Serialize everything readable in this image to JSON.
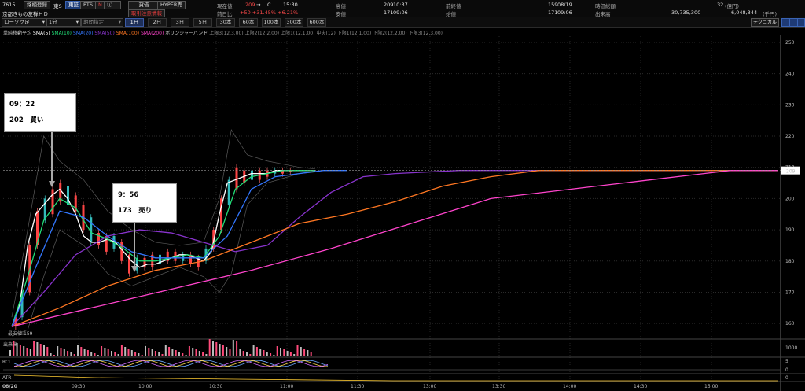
{
  "header": {
    "code": "7615",
    "register_label": "銘柄登録",
    "exchange": "東S",
    "company": "京都きもの友禅ＨＤ",
    "toshou_btn": "東証",
    "pts_btn": "PTS",
    "n_btn": "N",
    "ita_btn": "建",
    "hyper_btn": "HYPER売",
    "trade_btn": "貸借",
    "warning": "取引注意情報",
    "fields": [
      {
        "label": "現在値",
        "value": "209",
        "extra": "C",
        "time": "15:30"
      },
      {
        "label": "前日比",
        "value": "+50  +31.45%  +6.21%"
      },
      {
        "label": "高値",
        "value": "209",
        "time": "10:37"
      },
      {
        "label": "安値",
        "value": "171",
        "time": "09:06"
      },
      {
        "label": "前終値",
        "value": "159",
        "time": "08/19"
      },
      {
        "label": "始値",
        "value": "171",
        "time": "09:06"
      },
      {
        "label": "時価総額",
        "value": "32",
        "unit": "(億円)"
      },
      {
        "label": "出来高",
        "value": "30,735,300",
        "extra": "6,048,344",
        "unit": "(千円)"
      }
    ]
  },
  "toolbar": {
    "chart_type": "ローソク足",
    "interval": "1分",
    "period": "期間指定",
    "ranges": [
      "1日",
      "2日",
      "3日",
      "5日",
      "30本",
      "60本",
      "100本",
      "300本",
      "600本"
    ],
    "active_range": "1日",
    "technical_btn": "テクニカル"
  },
  "legend": [
    {
      "text": "単純移動平均",
      "color": "#cccccc"
    },
    {
      "text": "SMA(5)",
      "color": "#ffffff"
    },
    {
      "text": "SMA(10)",
      "color": "#22dd77"
    },
    {
      "text": "SMA(20)",
      "color": "#3377ff"
    },
    {
      "text": "SMA(50)",
      "color": "#8833cc"
    },
    {
      "text": "SMA(100)",
      "color": "#ff7722"
    },
    {
      "text": "SMA(200)",
      "color": "#ff44cc"
    },
    {
      "text": "ボリンジャーバンド",
      "color": "#cccccc"
    },
    {
      "text": "上限3(12,3.00)",
      "color": "#888888"
    },
    {
      "text": "上限2(12,2.00)",
      "color": "#888888"
    },
    {
      "text": "上限1(12,1.00)",
      "color": "#888888"
    },
    {
      "text": "中央(12)",
      "color": "#888888"
    },
    {
      "text": "下限1(12,1.00)",
      "color": "#888888"
    },
    {
      "text": "下限2(12,2.00)",
      "color": "#888888"
    },
    {
      "text": "下限3(12,3.00)",
      "color": "#888888"
    }
  ],
  "annotations": [
    {
      "time": "09：22",
      "text": "202　買い"
    },
    {
      "time": "9：56",
      "text": "173　売り"
    }
  ],
  "price_tag": "209",
  "low_label": "最安値:159",
  "volume_label": "出来高",
  "volume_axis": "1000",
  "rci_label": "RCI",
  "rci_axis": [
    "5",
    "0"
  ],
  "atr_label": "ATR",
  "atr_axis": "0",
  "date_label": "08/20",
  "chart_data": {
    "type": "line",
    "y_ticks": [
      160,
      170,
      180,
      190,
      200,
      210,
      220,
      230,
      240,
      250
    ],
    "ylim": [
      155,
      252
    ],
    "x_ticks": [
      "09:30",
      "10:00",
      "10:30",
      "11:00",
      "11:30",
      "13:00",
      "13:30",
      "14:00",
      "14:30",
      "15:00"
    ],
    "series": [
      {
        "name": "SMA(5)",
        "color": "#ffffff",
        "x": [
          0,
          10,
          20,
          30,
          40,
          50,
          60,
          70,
          80,
          90,
          100,
          110,
          120,
          130,
          140,
          150,
          160,
          170,
          180,
          190,
          200,
          210,
          220,
          230,
          240,
          250,
          260,
          270,
          280,
          290,
          300,
          310,
          320,
          330,
          340,
          350,
          360,
          370,
          380
        ],
        "values": [
          159,
          166,
          185,
          195,
          198,
          201,
          203,
          200,
          195,
          188,
          186,
          186,
          187,
          186,
          183,
          180,
          178,
          179,
          179,
          180,
          181,
          182,
          182,
          181,
          180,
          183,
          195,
          205,
          206,
          207,
          208,
          208,
          208,
          209,
          209,
          209,
          209,
          209,
          209
        ]
      },
      {
        "name": "SMA(10)",
        "color": "#22dd77",
        "x": [
          0,
          20,
          40,
          60,
          80,
          100,
          120,
          140,
          160,
          180,
          200,
          220,
          240,
          260,
          280,
          300,
          320,
          340,
          360,
          380
        ],
        "values": [
          159,
          175,
          193,
          200,
          197,
          189,
          187,
          184,
          180,
          180,
          181,
          182,
          181,
          188,
          203,
          207,
          208,
          209,
          209,
          209
        ]
      },
      {
        "name": "SMA(20)",
        "color": "#3377ff",
        "x": [
          0,
          30,
          60,
          90,
          120,
          150,
          180,
          210,
          240,
          270,
          300,
          330,
          360,
          390,
          420
        ],
        "values": [
          159,
          178,
          196,
          194,
          188,
          183,
          181,
          181,
          181,
          188,
          203,
          207,
          208,
          209,
          209
        ]
      },
      {
        "name": "SMA(50)",
        "color": "#8833cc",
        "x": [
          0,
          40,
          80,
          120,
          160,
          200,
          240,
          280,
          320,
          360,
          400,
          440,
          480,
          560,
          640,
          720,
          800,
          880,
          960
        ],
        "values": [
          159,
          170,
          182,
          188,
          190,
          189,
          186,
          183,
          185,
          194,
          202,
          207,
          208,
          209,
          209,
          209,
          209,
          209,
          209
        ]
      },
      {
        "name": "SMA(100)",
        "color": "#ff7722",
        "x": [
          0,
          60,
          120,
          180,
          240,
          300,
          360,
          420,
          480,
          540,
          600,
          660,
          720,
          800,
          880,
          960
        ],
        "values": [
          159,
          165,
          172,
          177,
          180,
          186,
          192,
          195,
          199,
          204,
          207,
          209,
          209,
          209,
          209,
          209
        ]
      },
      {
        "name": "SMA(200)",
        "color": "#ff44cc",
        "x": [
          0,
          100,
          200,
          300,
          400,
          500,
          600,
          700,
          800,
          900,
          960
        ],
        "values": [
          159,
          165,
          171,
          177,
          184,
          192,
          200,
          203,
          206,
          209,
          209
        ]
      }
    ],
    "volume": {
      "x_span": [
        0,
        400
      ],
      "max": 1000
    }
  }
}
